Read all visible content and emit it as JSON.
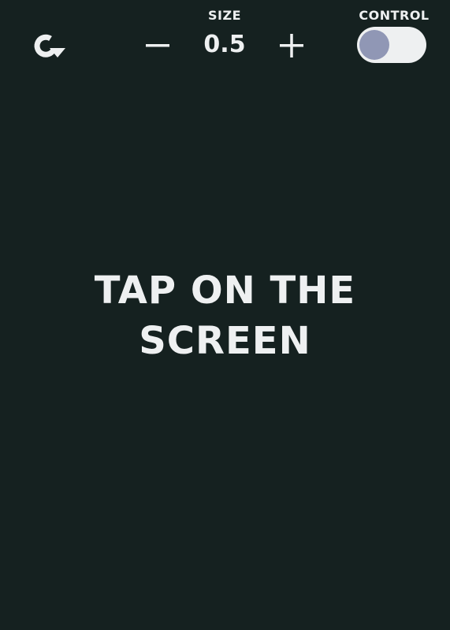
{
  "controls": {
    "size_label": "SIZE",
    "size_value": "0.5",
    "control_label": "CONTROL",
    "control_on": false
  },
  "prompt": {
    "line1": "TAP ON THE",
    "line2": "SCREEN"
  },
  "icons": {
    "restart": "restart-icon",
    "minus": "minus-icon",
    "plus": "plus-icon"
  },
  "colors": {
    "background": "#152120",
    "text": "#eef0f1",
    "toggle_track": "#eef0f1",
    "toggle_knob": "#9097b5"
  }
}
